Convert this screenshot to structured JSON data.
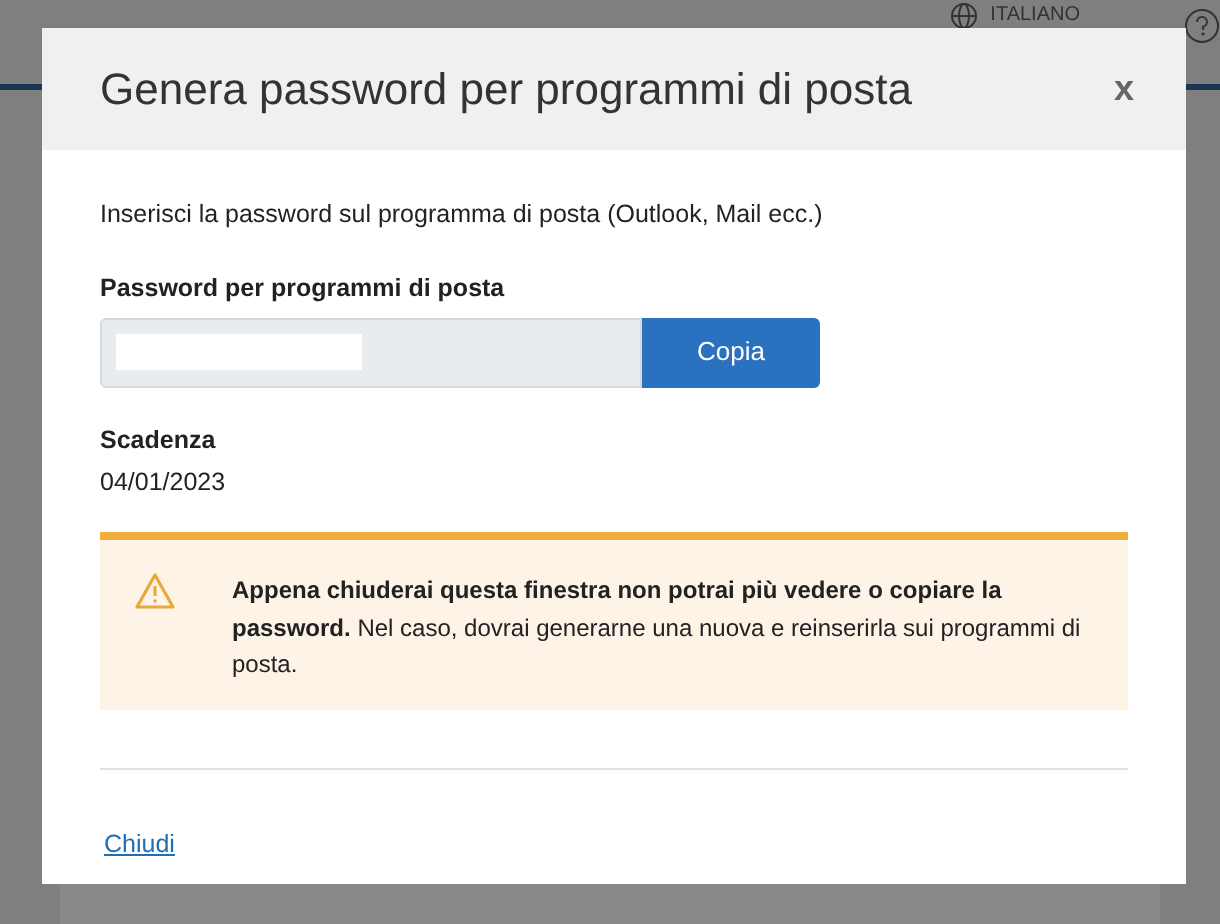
{
  "header": {
    "language": "ITALIANO"
  },
  "dialog": {
    "title": "Genera password per programmi di posta",
    "close": "x",
    "intro": "Inserisci la password sul programma di posta (Outlook, Mail ecc.)",
    "password_label": "Password per programmi di posta",
    "copy_button": "Copia",
    "expiry_label": "Scadenza",
    "expiry_value": "04/01/2023",
    "warning": "**Appena chiuderai questa finestra non potrai più vedere o copiare la password.** Nel caso, dovrai generarne una nuova e reinserirla sui programmi di posta.",
    "close_link": "Chiudi"
  }
}
